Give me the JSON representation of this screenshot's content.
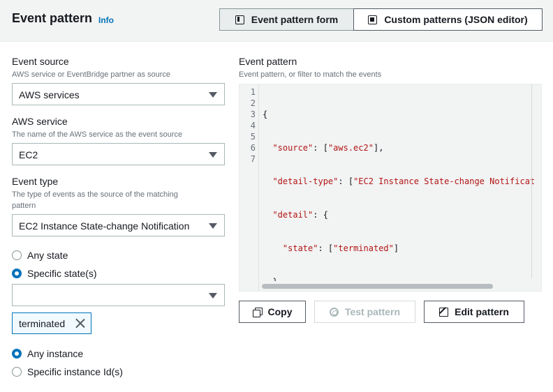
{
  "header": {
    "title": "Event pattern",
    "info_label": "Info",
    "tabs": [
      {
        "label": "Event pattern form",
        "icon": "form-icon",
        "active": true
      },
      {
        "label": "Custom patterns (JSON editor)",
        "icon": "json-editor-icon",
        "active": false
      }
    ]
  },
  "left": {
    "event_source": {
      "label": "Event source",
      "description": "AWS service or EventBridge partner as source",
      "value": "AWS services"
    },
    "aws_service": {
      "label": "AWS service",
      "description": "The name of the AWS service as the event source",
      "value": "EC2"
    },
    "event_type": {
      "label": "Event type",
      "description_line1": "The type of events as the source of the matching",
      "description_line2": "pattern",
      "value": "EC2 Instance State-change Notification"
    },
    "state_options": [
      {
        "label": "Any state",
        "checked": false
      },
      {
        "label": "Specific state(s)",
        "checked": true
      }
    ],
    "state_select_value": "",
    "token": {
      "label": "terminated"
    },
    "instance_options": [
      {
        "label": "Any instance",
        "checked": true
      },
      {
        "label": "Specific instance Id(s)",
        "checked": false
      }
    ]
  },
  "right": {
    "label": "Event pattern",
    "description": "Event pattern, or filter to match the events",
    "line_numbers": [
      "1",
      "2",
      "3",
      "4",
      "5",
      "6",
      "7"
    ],
    "code": {
      "l1": "{",
      "l2_key": "\"source\"",
      "l2_rest": ": [",
      "l2_val": "\"aws.ec2\"",
      "l2_end": "],",
      "l3_key": "\"detail-type\"",
      "l3_rest": ": [",
      "l3_val": "\"EC2 Instance State-change Notificat",
      "l4_key": "\"detail\"",
      "l4_rest": ": {",
      "l5_key": "\"state\"",
      "l5_rest": ": [",
      "l5_val": "\"terminated\"",
      "l5_end": "]",
      "l6": "}",
      "l7": "}"
    },
    "buttons": {
      "copy": "Copy",
      "test": "Test pattern",
      "edit": "Edit pattern"
    }
  },
  "colors": {
    "accent": "#0073bb",
    "code_string": "#b31515",
    "header_bg": "#f2f3f3"
  }
}
